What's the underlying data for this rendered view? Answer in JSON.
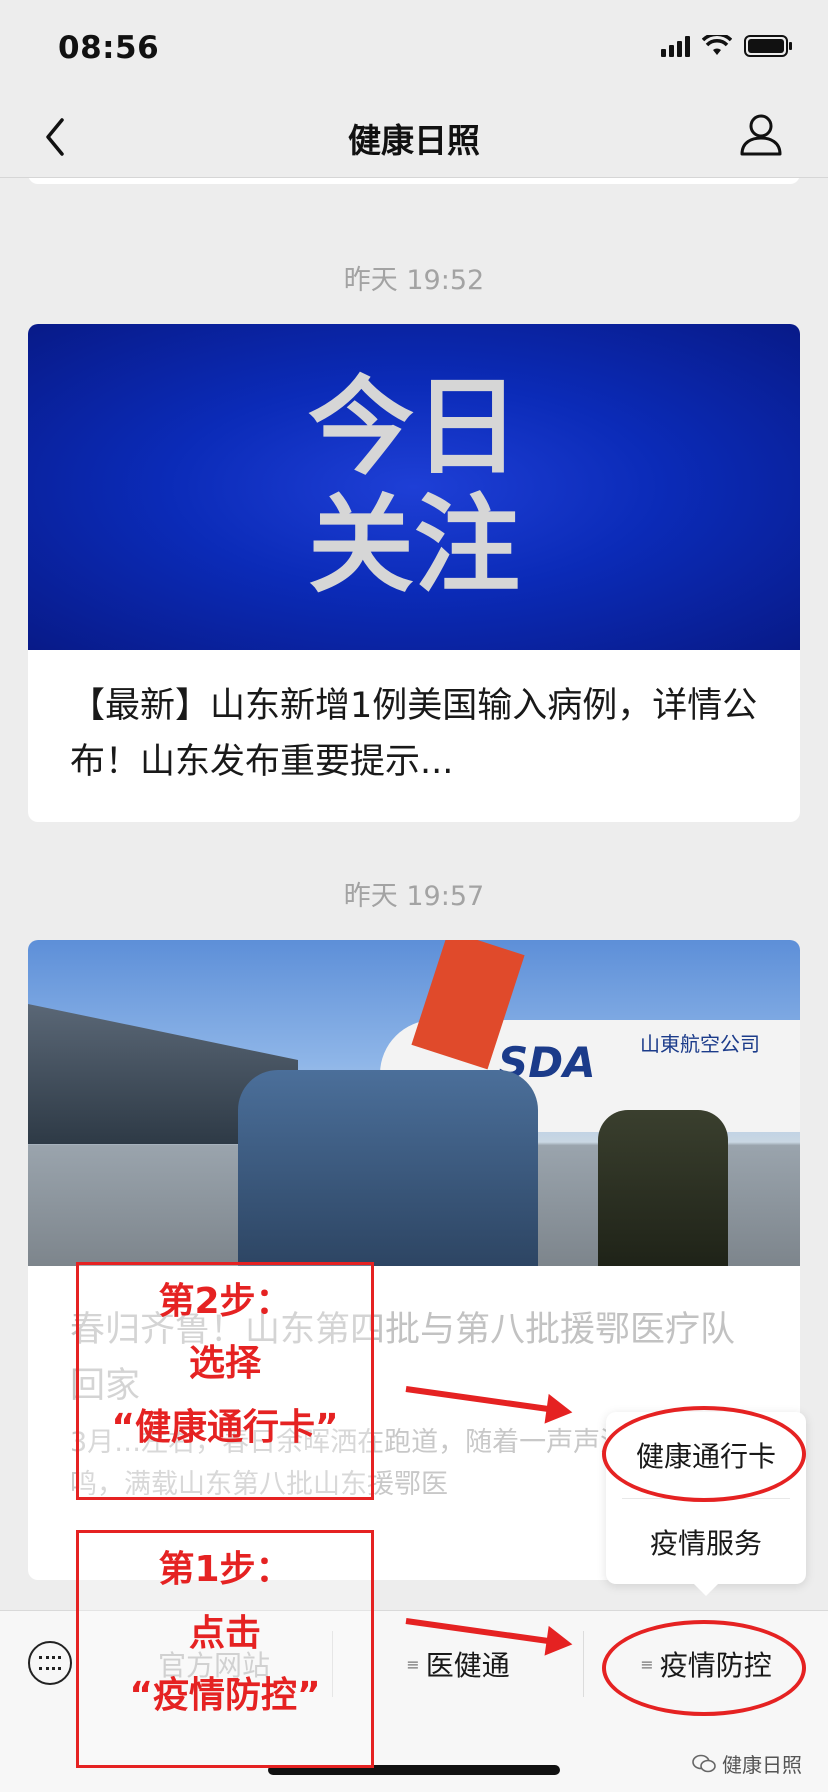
{
  "status_bar": {
    "time": "08:56"
  },
  "nav": {
    "title": "健康日照"
  },
  "feed": [
    {
      "timestamp": "昨天 19:52",
      "banner_text_line1": "今日",
      "banner_text_line2": "关注",
      "title": "【最新】山东新增1例美国输入病例，详情公布！山东发布重要提示..."
    },
    {
      "timestamp": "昨天 19:57",
      "photo_logo": "SDA",
      "photo_airline": "山東航空公司",
      "title": "春归齐鲁！山东第四批与第八批援鄂医疗队回家",
      "desc": "3月…左右，春日余晖洒在跑道，随着一声声渐近的轰鸣，满载山东第八批山东援鄂医"
    }
  ],
  "popup_menu": {
    "items": [
      "健康通行卡",
      "疫情服务"
    ]
  },
  "bottom_menu": {
    "items": [
      "官方网站",
      "医健通",
      "疫情防控"
    ]
  },
  "annotations": {
    "step2": {
      "line1": "第2步：",
      "line2": "选择",
      "line3": "“健康通行卡”"
    },
    "step1": {
      "line1": "第1步：",
      "line2": "点击",
      "line3": "“疫情防控”"
    },
    "color": "#e52222"
  },
  "watermark": "健康日照"
}
